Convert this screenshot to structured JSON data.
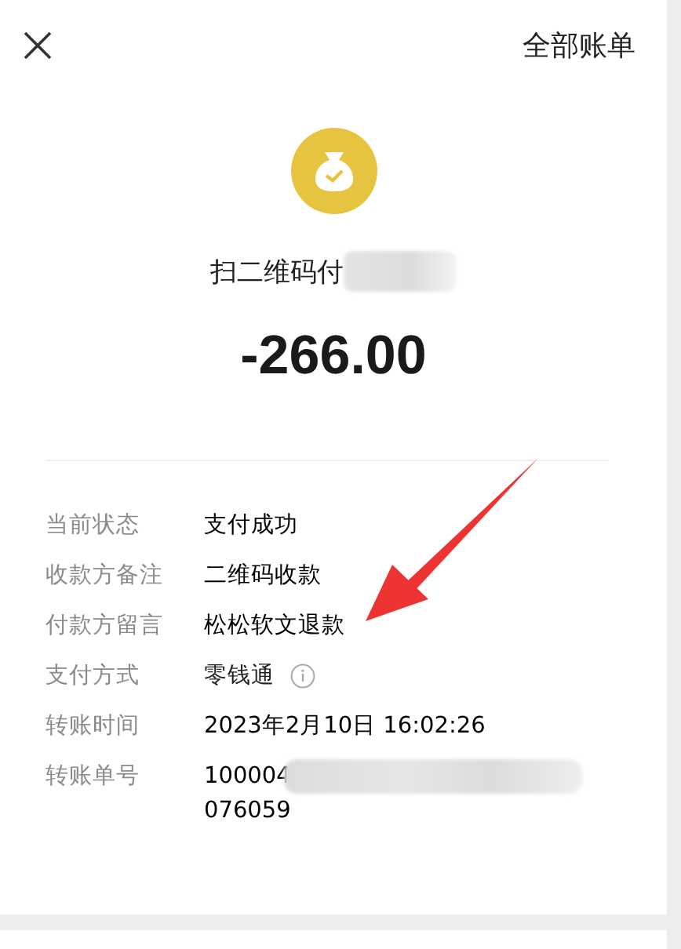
{
  "header": {
    "all_bills": "全部账单"
  },
  "summary": {
    "title": "扫二维码付",
    "title_redacted": true,
    "amount": "-266.00"
  },
  "details": [
    {
      "label": "当前状态",
      "value": "支付成功",
      "kind": "text"
    },
    {
      "label": "收款方备注",
      "value": "二维码收款",
      "kind": "text"
    },
    {
      "label": "付款方留言",
      "value": "松松软文退款",
      "kind": "text"
    },
    {
      "label": "支付方式",
      "value": "零钱通",
      "kind": "info"
    },
    {
      "label": "转账时间",
      "value": "2023年2月10日 16:02:26",
      "kind": "text"
    },
    {
      "label": "转账单号",
      "lines": [
        "100004",
        "076059"
      ],
      "kind": "redacted"
    }
  ],
  "annotation": {
    "kind": "arrow"
  }
}
